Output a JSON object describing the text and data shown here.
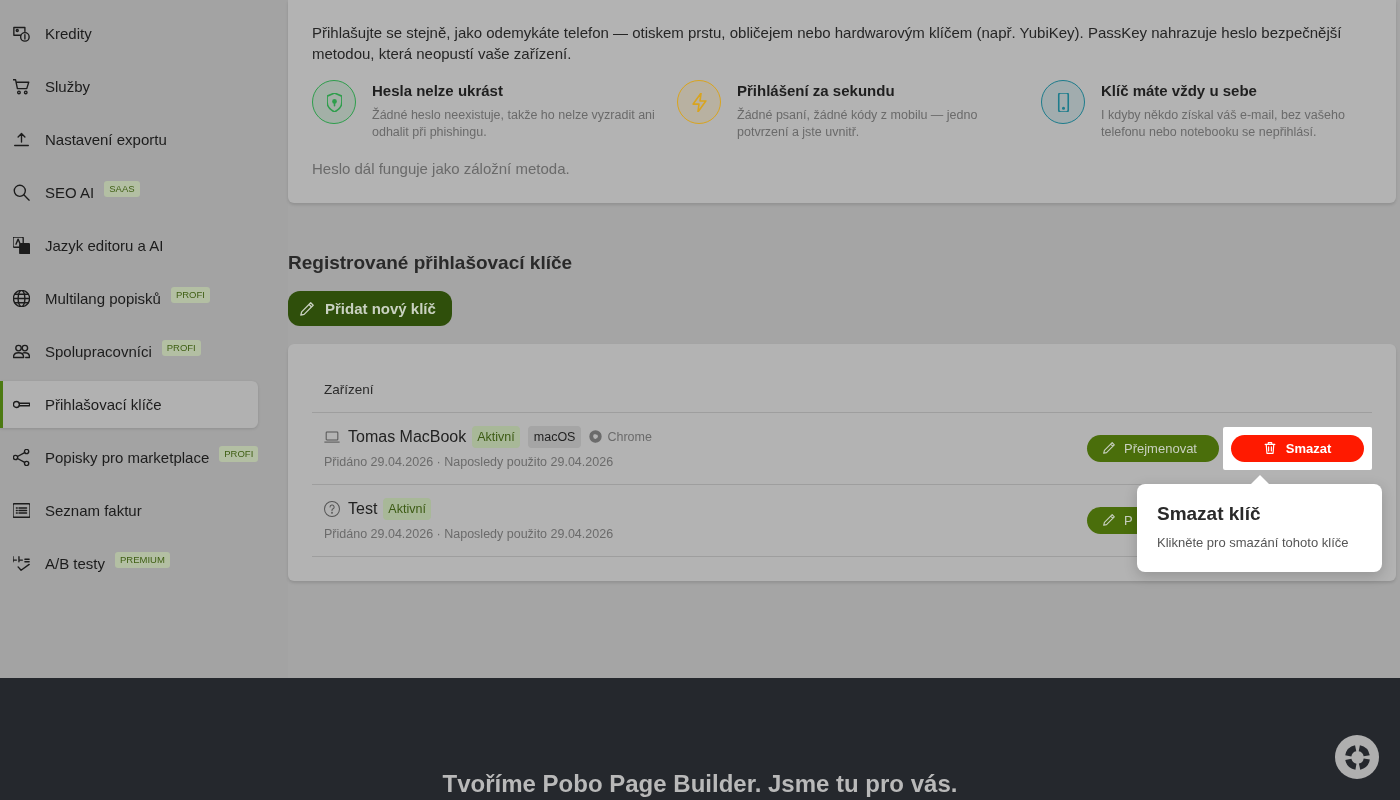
{
  "sidebar": {
    "items": [
      {
        "label": "Kredity",
        "selected": false
      },
      {
        "label": "Služby",
        "selected": false
      },
      {
        "label": "Nastavení exportu",
        "selected": false
      },
      {
        "label": "SEO AI",
        "badge": "SAAS",
        "selected": false
      },
      {
        "label": "Jazyk editoru a AI",
        "selected": false
      },
      {
        "label": "Multilang popisků",
        "badge": "PROFI",
        "selected": false
      },
      {
        "label": "Spolupracovníci",
        "badge": "PROFI",
        "selected": false
      },
      {
        "label": "Přihlašovací klíče",
        "selected": true
      },
      {
        "label": "Popisky pro marketplace",
        "badge": "PROFI",
        "selected": false
      },
      {
        "label": "Seznam faktur",
        "selected": false
      },
      {
        "label": "A/B testy",
        "badge": "PREMIUM",
        "selected": false
      }
    ]
  },
  "intro": {
    "text": "Přihlašujte se stejně, jako odemykáte telefon — otiskem prstu, obličejem nebo hardwarovým klíčem (např. YubiKey). PassKey nahrazuje heslo bezpečnější metodou, která neopustí vaše zařízení.",
    "features": [
      {
        "title": "Hesla nelze ukrást",
        "description": "Žádné heslo neexistuje, takže ho nelze vyzradit ani odhalit při phishingu.",
        "color": "#2e9e4c"
      },
      {
        "title": "Přihlášení za sekundu",
        "description": "Žádné psaní, žádné kódy z mobilu — jedno potvrzení a jste uvnitř.",
        "color": "#d9a41e"
      },
      {
        "title": "Klíč máte vždy u sebe",
        "description": "I kdyby někdo získal váš e-mail, bez vašeho telefonu nebo notebooku se nepřihlásí.",
        "color": "#1d7c8c"
      }
    ],
    "note": "Heslo dál funguje jako záložní metoda."
  },
  "keys": {
    "title": "Registrované přihlašovací klíče",
    "add_button": "Přidat nový klíč",
    "columns": [
      "Zařízení"
    ],
    "rows": [
      {
        "kind": "device",
        "name": "Tomas MacBook",
        "status": "Aktivní",
        "os": "macOS",
        "browser": "Chrome",
        "meta": "Přidáno 29.04.2026 · Naposledy použito 29.04.2026",
        "actions": [
          {
            "kind": "rename",
            "label": "Přejmenovat",
            "highlighted": false
          },
          {
            "kind": "delete",
            "label": "Smazat",
            "highlighted": true
          }
        ]
      },
      {
        "kind": "unknown",
        "name": "Test",
        "status": "Aktivní",
        "meta": "Přidáno 29.04.2026 · Naposledy použito 29.04.2026",
        "actions": [
          {
            "kind": "rename",
            "label": "P",
            "highlighted": false
          }
        ]
      }
    ]
  },
  "tooltip": {
    "title": "Smazat klíč",
    "text": "Klikněte pro smazání tohoto klíče"
  },
  "footer": {
    "headline": "Tvoříme Pobo Page Builder. Jsme tu pro vás."
  }
}
